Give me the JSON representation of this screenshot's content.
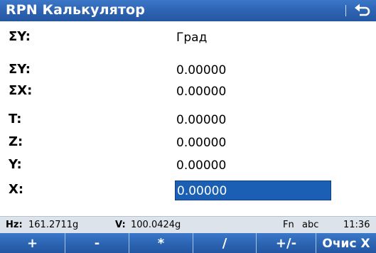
{
  "app": {
    "title": "RPN Калькулятор",
    "back_icon": "undo-arrow-icon"
  },
  "rows": {
    "sum_y_mode": {
      "label": "ΣY:",
      "value": "Град"
    },
    "sum_y": {
      "label": "ΣY:",
      "value": "0.00000"
    },
    "sum_x": {
      "label": "ΣX:",
      "value": "0.00000"
    },
    "t": {
      "label": "T:",
      "value": "0.00000"
    },
    "z": {
      "label": "Z:",
      "value": "0.00000"
    },
    "y": {
      "label": "Y:",
      "value": "0.00000"
    },
    "x": {
      "label": "X:",
      "value": "0.00000"
    }
  },
  "status": {
    "hz_label": "Hz:",
    "hz_value": "161.2711g",
    "v_label": "V:",
    "v_value": "100.0424g",
    "fn": "Fn",
    "input_mode": "abc",
    "time": "11:36"
  },
  "fkeys": {
    "f1": "+",
    "f2": "-",
    "f3": "*",
    "f4": "/",
    "f5": "+/-",
    "f6": "Очис X"
  },
  "colors": {
    "bar_blue": "#2c62b0",
    "selection_blue": "#1a5fb4",
    "status_bg": "#dde3ea"
  }
}
